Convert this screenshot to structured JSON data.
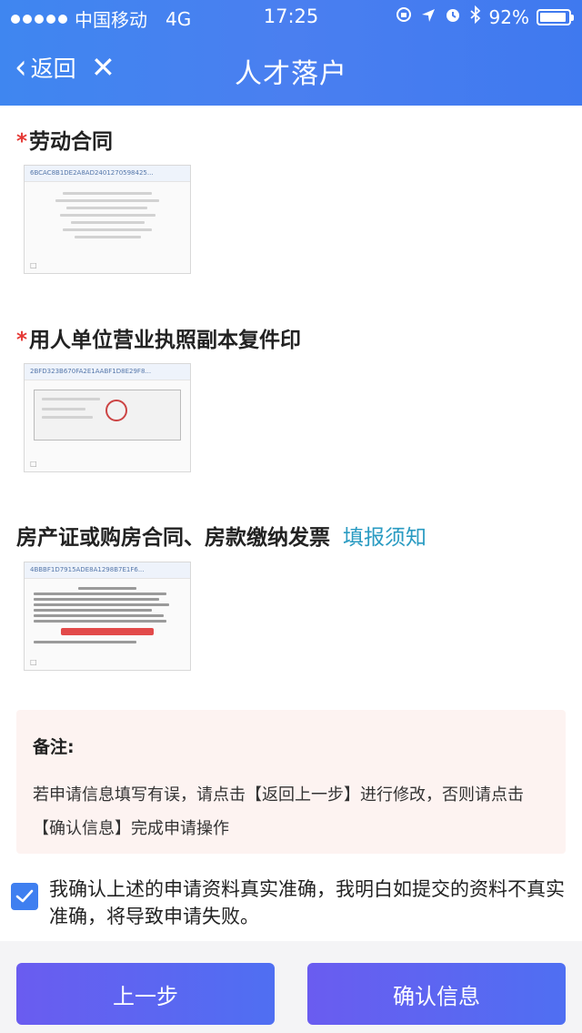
{
  "status_bar": {
    "carrier": "中国移动",
    "network": "4G",
    "time": "17:25",
    "battery": "92%",
    "battery_level": 0.92
  },
  "nav": {
    "back_label": "返回",
    "title": "人才落户"
  },
  "sections": [
    {
      "label": "劳动合同",
      "required": true,
      "thumb_header": "6BCAC8B1DE2A8AD2401270598425..."
    },
    {
      "label": "用人单位营业执照副本复件印",
      "required": true,
      "thumb_header": "2BFD323B670FA2E1AABF1D8E29F8..."
    },
    {
      "label": "房产证或购房合同、房款缴纳发票",
      "required": false,
      "link": "填报须知",
      "thumb_header": "4BBBF1D7915ADE8A1298B7E1F6..."
    }
  ],
  "remark": {
    "title": "备注:",
    "text": "若申请信息填写有误，请点击【返回上一步】进行修改，否则请点击【确认信息】完成申请操作"
  },
  "agreement": {
    "checked": true,
    "text": "我确认上述的申请资料真实准确，我明白如提交的资料不真实准确，将导致申请失败。"
  },
  "buttons": {
    "prev": "上一步",
    "confirm": "确认信息"
  },
  "colors": {
    "nav_bg": "#4a7ff0",
    "required_mark": "#e53935",
    "link": "#2a9bc2",
    "button": "#5a66f1",
    "remark_bg": "#fdf3f1"
  }
}
